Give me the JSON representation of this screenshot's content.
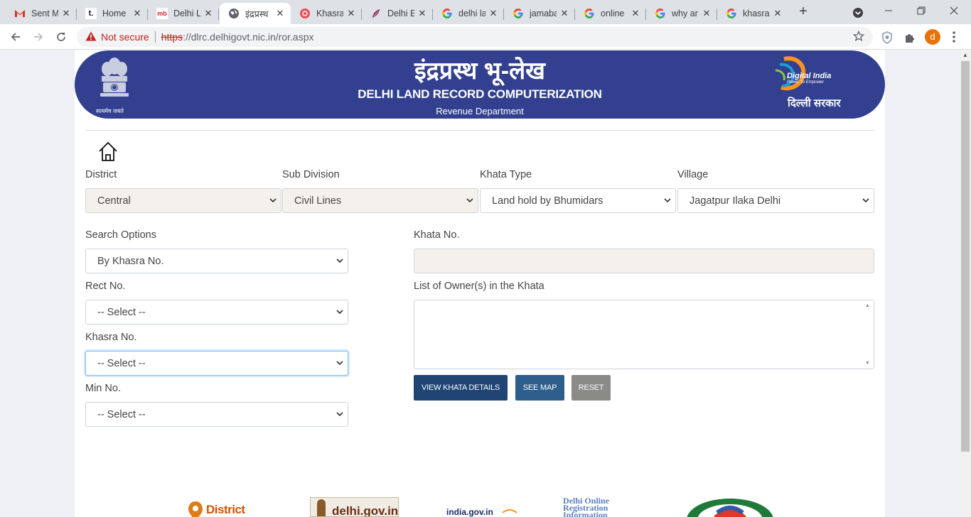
{
  "browser": {
    "tabs": [
      {
        "title": "Sent M",
        "icon": "gmail-icon"
      },
      {
        "title": "Home",
        "icon": "tumblr-icon"
      },
      {
        "title": "Delhi L",
        "icon": "magicbricks-icon"
      },
      {
        "title": "इंद्रप्रस्थ",
        "icon": "globe-icon",
        "active": true
      },
      {
        "title": "Khasra",
        "icon": "red-globe-icon"
      },
      {
        "title": "Delhi E",
        "icon": "feather-icon"
      },
      {
        "title": "delhi la",
        "icon": "google-icon"
      },
      {
        "title": "jamaba",
        "icon": "google-icon"
      },
      {
        "title": "online",
        "icon": "google-icon"
      },
      {
        "title": "why ar",
        "icon": "google-icon"
      },
      {
        "title": "khasra",
        "icon": "google-icon"
      }
    ],
    "not_secure": "Not secure",
    "url_scheme": "https",
    "url_rest": "://dlrc.delhigovt.nic.in/ror.aspx",
    "profile_initial": "d"
  },
  "banner": {
    "hindi_title": "इंद्रप्रस्थ भू-लेख",
    "english_title": "DELHI LAND RECORD COMPUTERIZATION",
    "department": "Revenue Department",
    "emblem_caption": "सत्यमेव जयते",
    "digital_india": "Digital India",
    "digital_india_tagline": "Power To Empower",
    "delhi_sarkar": "दिल्ली सरकार"
  },
  "form": {
    "district": {
      "label": "District",
      "value": "Central"
    },
    "sub_division": {
      "label": "Sub Division",
      "value": "Civil Lines"
    },
    "khata_type": {
      "label": "Khata Type",
      "value": "Land hold by Bhumidars"
    },
    "village": {
      "label": "Village",
      "value": "Jagatpur Ilaka Delhi"
    },
    "search_options": {
      "label": "Search Options",
      "value": "By Khasra No."
    },
    "rect_no": {
      "label": "Rect No.",
      "value": "-- Select --"
    },
    "khasra_no": {
      "label": "Khasra No.",
      "value": "-- Select --"
    },
    "min_no": {
      "label": "Min No.",
      "value": "-- Select --"
    },
    "khata_no": {
      "label": "Khata No.",
      "value": ""
    },
    "owners": {
      "label": "List of Owner(s) in the Khata",
      "value": ""
    }
  },
  "buttons": {
    "view_khata": "VIEW KHATA DETAILS",
    "see_map": "SEE MAP",
    "reset": "RESET"
  },
  "footer_logos": {
    "district_delhi": "District Delhi",
    "delhi_gov": "delhi.gov.in",
    "india_gov": "india.gov.in",
    "dor_line1": "Delhi Online",
    "dor_line2": "Registration",
    "dor_line3": "Information"
  },
  "colors": {
    "banner": "#32408f",
    "khata_button": "#1f4575",
    "map_button": "#2d5e8c",
    "reset_button": "#8a8a86"
  }
}
